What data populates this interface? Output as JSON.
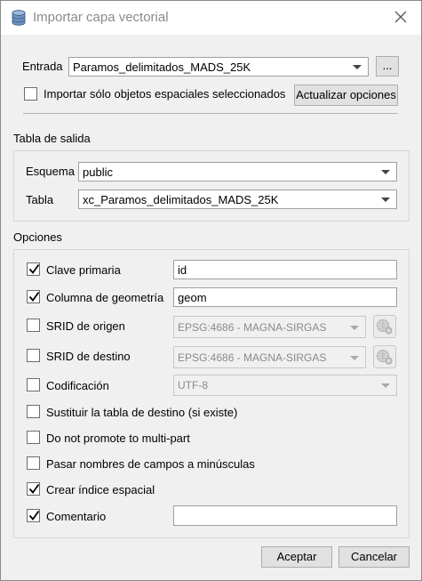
{
  "window": {
    "title": "Importar capa vectorial"
  },
  "input": {
    "label": "Entrada",
    "value": "Paramos_delimitados_MADS_25K",
    "browse_label": "...",
    "selected_only_label": "Importar sólo objetos espaciales seleccionados",
    "selected_only_checked": false,
    "update_label": "Actualizar opciones"
  },
  "output": {
    "group_title": "Tabla de salida",
    "schema_label": "Esquema",
    "schema_value": "public",
    "table_label": "Tabla",
    "table_value": "xc_Paramos_delimitados_MADS_25K"
  },
  "options": {
    "group_title": "Opciones",
    "primary_key": {
      "label": "Clave primaria",
      "checked": true,
      "value": "id"
    },
    "geometry_column": {
      "label": "Columna de geometría",
      "checked": true,
      "value": "geom"
    },
    "source_srid": {
      "label": "SRID de origen",
      "checked": false,
      "value": "EPSG:4686 - MAGNA-SIRGAS"
    },
    "target_srid": {
      "label": "SRID de destino",
      "checked": false,
      "value": "EPSG:4686 - MAGNA-SIRGAS"
    },
    "encoding": {
      "label": "Codificación",
      "checked": false,
      "value": "UTF-8"
    },
    "replace_table": {
      "label": "Sustituir la tabla de destino (si existe)",
      "checked": false
    },
    "no_multipart": {
      "label": "Do not promote to multi-part",
      "checked": false
    },
    "lowercase_fields": {
      "label": "Pasar nombres de campos a minúsculas",
      "checked": false
    },
    "spatial_index": {
      "label": "Crear índice espacial",
      "checked": true
    },
    "comment": {
      "label": "Comentario",
      "checked": true,
      "value": ""
    }
  },
  "buttons": {
    "ok": "Aceptar",
    "cancel": "Cancelar"
  },
  "icons": {
    "app": "database-icon",
    "close": "close-icon",
    "crs": "crs-selector-icon",
    "check": "checkmark-icon"
  }
}
